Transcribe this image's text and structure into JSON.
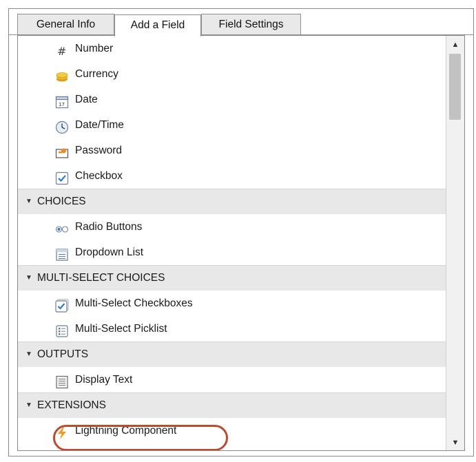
{
  "tabs": [
    {
      "label": "General Info"
    },
    {
      "label": "Add a Field"
    },
    {
      "label": "Field Settings"
    }
  ],
  "items_top": [
    {
      "label": "Number",
      "icon": "hash-icon"
    },
    {
      "label": "Currency",
      "icon": "coins-icon"
    },
    {
      "label": "Date",
      "icon": "calendar-icon",
      "icon_text": "17"
    },
    {
      "label": "Date/Time",
      "icon": "clock-icon"
    },
    {
      "label": "Password",
      "icon": "key-icon"
    },
    {
      "label": "Checkbox",
      "icon": "checkbox-icon"
    }
  ],
  "sections": {
    "choices": {
      "label": "CHOICES",
      "items": [
        {
          "label": "Radio Buttons",
          "icon": "radio-icon"
        },
        {
          "label": "Dropdown List",
          "icon": "dropdown-icon"
        }
      ]
    },
    "multi": {
      "label": "MULTI-SELECT CHOICES",
      "items": [
        {
          "label": "Multi-Select Checkboxes",
          "icon": "multi-checkbox-icon"
        },
        {
          "label": "Multi-Select Picklist",
          "icon": "picklist-icon"
        }
      ]
    },
    "outputs": {
      "label": "OUTPUTS",
      "items": [
        {
          "label": "Display Text",
          "icon": "document-icon"
        }
      ]
    },
    "extensions": {
      "label": "EXTENSIONS",
      "items": [
        {
          "label": "Lightning Component",
          "icon": "lightning-icon"
        }
      ]
    }
  },
  "colors": {
    "highlight": "#c0482c",
    "section_bg": "#e8e8e8",
    "checkbox_blue": "#2f7bd6",
    "lightning_orange": "#f39a1e"
  },
  "scroll": {
    "up_glyph": "▲",
    "down_glyph": "▼"
  }
}
